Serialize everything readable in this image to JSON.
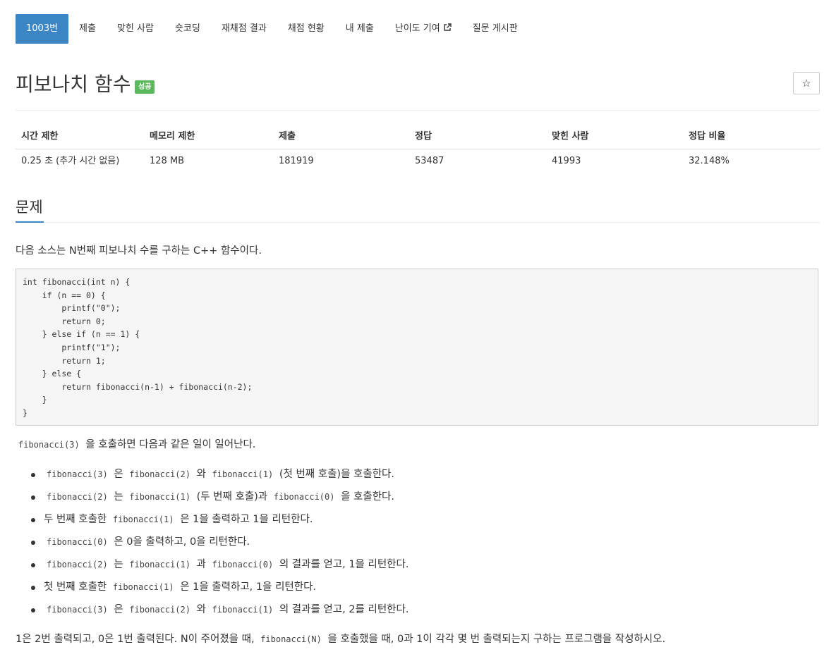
{
  "nav": {
    "items": [
      {
        "label": "1003번",
        "active": true
      },
      {
        "label": "제출",
        "active": false
      },
      {
        "label": "맞힌 사람",
        "active": false
      },
      {
        "label": "숏코딩",
        "active": false
      },
      {
        "label": "재채점 결과",
        "active": false
      },
      {
        "label": "채점 현황",
        "active": false
      },
      {
        "label": "내 제출",
        "active": false
      },
      {
        "label": "난이도 기여",
        "active": false,
        "icon": "external-link-icon"
      },
      {
        "label": "질문 게시판",
        "active": false
      }
    ]
  },
  "problem": {
    "title": "피보나치 함수",
    "badge": "성공",
    "badge_color": "#5cb85c",
    "star_icon": "☆"
  },
  "info": {
    "headers": [
      "시간 제한",
      "메모리 제한",
      "제출",
      "정답",
      "맞힌 사람",
      "정답 비율"
    ],
    "values": [
      "0.25 초 (추가 시간 없음)",
      "128 MB",
      "181919",
      "53487",
      "41993",
      "32.148%"
    ]
  },
  "section": {
    "title": "문제",
    "intro": "다음 소스는 N번째 피보나치 수를 구하는 C++ 함수이다.",
    "code": [
      "int fibonacci(int n) {",
      "    if (n == 0) {",
      "        printf(\"0\");",
      "        return 0;",
      "    } else if (n == 1) {",
      "        printf(\"1\");",
      "        return 1;",
      "    } else {",
      "        return fibonacci(n-1) + fibonacci(n-2);",
      "    }",
      "}"
    ],
    "call_line": {
      "code": "fibonacci(3)",
      "text": "을 호출하면 다음과 같은 일이 일어난다."
    },
    "steps": [
      {
        "c1": "fibonacci(3)",
        "t1": "은",
        "c2": "fibonacci(2)",
        "t2": "와",
        "c3": "fibonacci(1)",
        "t3": "(첫 번째 호출)을 호출한다."
      },
      {
        "c1": "fibonacci(2)",
        "t1": "는",
        "c2": "fibonacci(1)",
        "t2": "(두 번째 호출)과",
        "c3": "fibonacci(0)",
        "t3": "을 호출한다."
      },
      {
        "p0": "두 번째 호출한",
        "c1": "fibonacci(1)",
        "t1": "은 1을 출력하고 1을 리턴한다."
      },
      {
        "c1": "fibonacci(0)",
        "t1": "은 0을 출력하고, 0을 리턴한다."
      },
      {
        "c1": "fibonacci(2)",
        "t1": "는",
        "c2": "fibonacci(1)",
        "t2": "과",
        "c3": "fibonacci(0)",
        "t3": "의 결과를 얻고, 1을 리턴한다."
      },
      {
        "p0": "첫 번째 호출한",
        "c1": "fibonacci(1)",
        "t1": "은 1을 출력하고, 1을 리턴한다."
      },
      {
        "c1": "fibonacci(3)",
        "t1": "은",
        "c2": "fibonacci(2)",
        "t2": "와",
        "c3": "fibonacci(1)",
        "t3": "의 결과를 얻고, 2를 리턴한다."
      }
    ],
    "final": {
      "pre": "1은 2번 출력되고, 0은 1번 출력된다. N이 주어졌을 때,",
      "code": "fibonacci(N)",
      "post": "을 호출했을 때, 0과 1이 각각 몇 번 출력되는지 구하는 프로그램을 작성하시오."
    }
  },
  "colors": {
    "accent": "#3d86c6",
    "success": "#5cb85c"
  }
}
